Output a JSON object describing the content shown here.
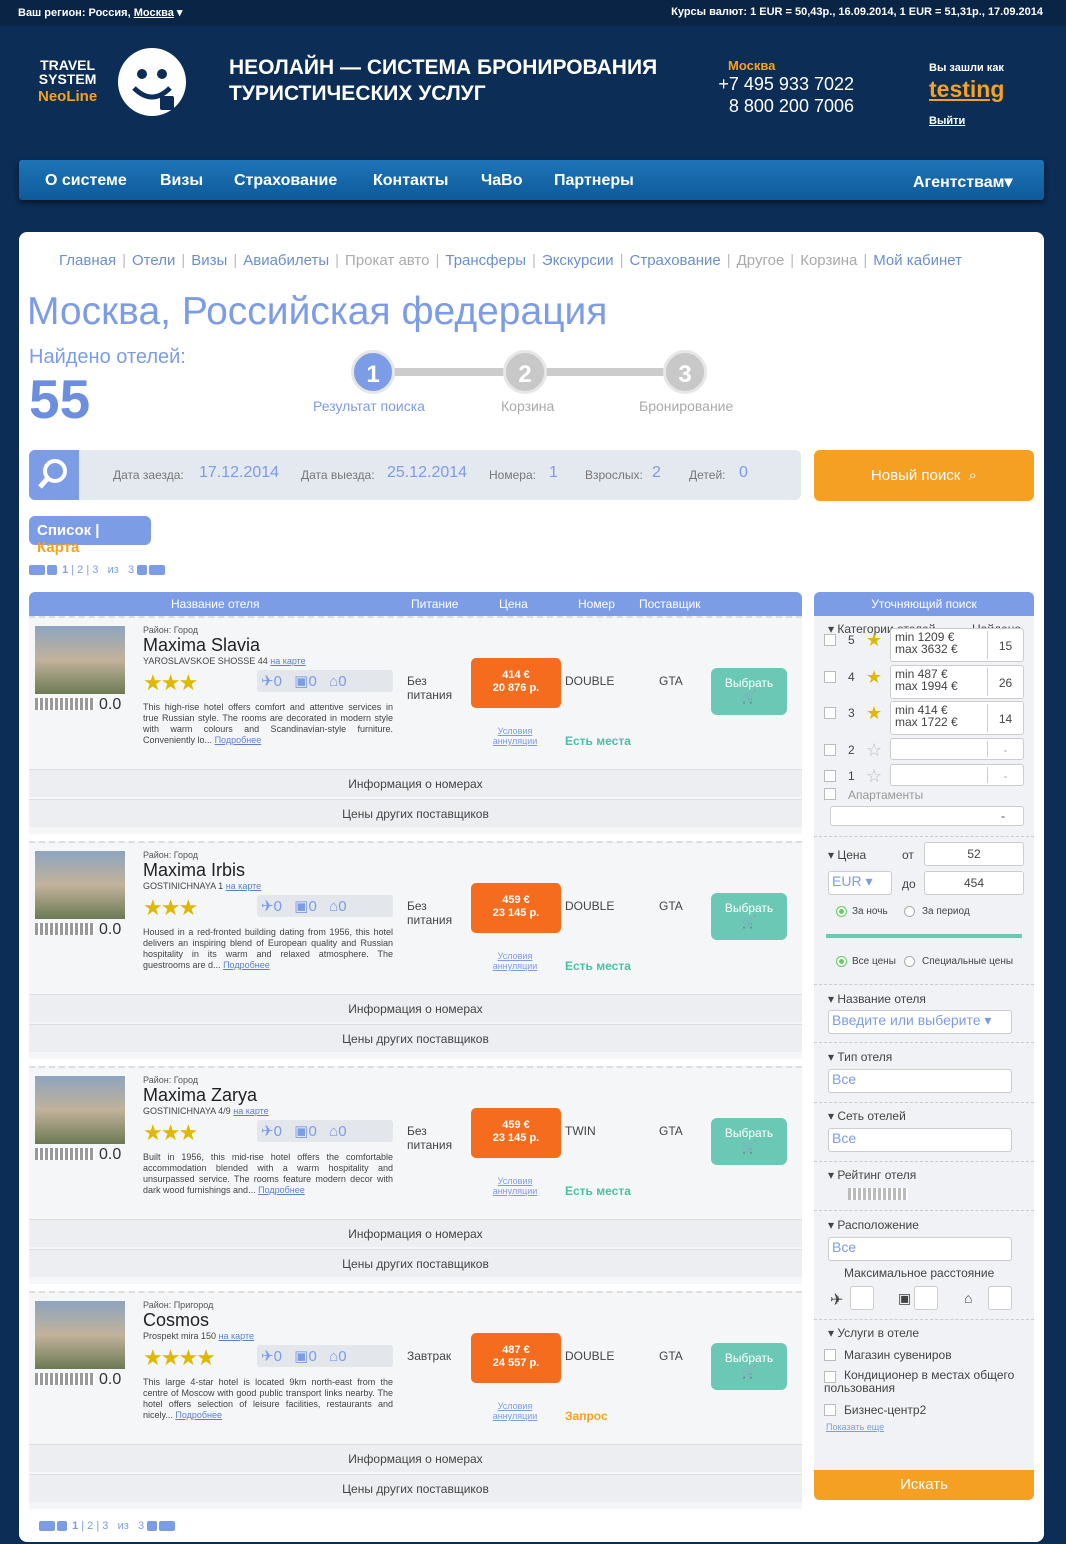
{
  "topbar": {
    "region_label": "Ваш регион: Россия,",
    "region_value": "Москва",
    "rates": "Курсы валют: 1 EUR = 50,43р., 16.09.2014, 1 EUR = 51,31р., 17.09.2014"
  },
  "brand": {
    "line1": "TRAVEL",
    "line2": "SYSTEM",
    "line3": "NeoLine",
    "headline1": "НЕОЛАЙН — СИСТЕМА БРОНИРОВАНИЯ",
    "headline2": "ТУРИСТИЧЕСКИХ УСЛУГ"
  },
  "contacts": {
    "city": "Москва",
    "phone1": "+7 495 933 7022",
    "phone2": "8 800 200 7006"
  },
  "user": {
    "label": "Вы зашли как",
    "name": "testing",
    "logout": "Выйти"
  },
  "nav": {
    "items": [
      "О системе",
      "Визы",
      "Страхование",
      "Контакты",
      "ЧаВо",
      "Партнеры"
    ],
    "agencies": "Агентствам"
  },
  "crumbs": [
    "Главная",
    "Отели",
    "Визы",
    "Авиабилеты",
    "Прокат авто",
    "Трансферы",
    "Экскурсии",
    "Страхование",
    "Другое",
    "Корзина",
    "Мой кабинет"
  ],
  "page": {
    "title": "Москва, Российская федерация",
    "found_label": "Найдено отелей:",
    "found_count": "55"
  },
  "steps": [
    {
      "n": "1",
      "label": "Результат поиска"
    },
    {
      "n": "2",
      "label": "Корзина"
    },
    {
      "n": "3",
      "label": "Бронирование"
    }
  ],
  "search": {
    "checkin_label": "Дата заезда:",
    "checkin": "17.12.2014",
    "checkout_label": "Дата выезда:",
    "checkout": "25.12.2014",
    "rooms_label": "Номера:",
    "rooms": "1",
    "adults_label": "Взрослых:",
    "adults": "2",
    "kids_label": "Детей:",
    "kids": "0",
    "new_search": "Новый поиск"
  },
  "view": {
    "list": "Список",
    "map": "Карта"
  },
  "pager": {
    "p1": "1",
    "p2": "2",
    "p3": "3",
    "of": "из",
    "total": "3"
  },
  "listhead": {
    "name": "Название отеля",
    "meal": "Питание",
    "price": "Цена",
    "room": "Номер",
    "provider": "Поставщик"
  },
  "hotels": [
    {
      "district": "Район: Город",
      "name": "Maxima Slavia",
      "addr": "YAROSLAVSKOE SHOSSE 44",
      "map": "на карте",
      "stars": "★★★",
      "d1": "0",
      "d2": "0",
      "d3": "0",
      "score": "0.0",
      "desc": "This high-rise hotel offers comfort and attentive services in true Russian style. The rooms are decorated in modern style with warm colours and Scandinavian-style furniture. Conveniently lo...",
      "more": "Подробнее",
      "meal": "Без питания",
      "eur": "414 €",
      "rub": "20 876 р.",
      "cancel": "Условия аннуляции",
      "room": "DOUBLE",
      "provider": "GTA",
      "avail": "Есть места",
      "choose": "Выбрать",
      "info": "Информация о номерах",
      "other": "Цены других поставщиков"
    },
    {
      "district": "Район: Город",
      "name": "Maxima Irbis",
      "addr": "GOSTINICHNAYA 1",
      "map": "на карте",
      "stars": "★★★",
      "d1": "0",
      "d2": "0",
      "d3": "0",
      "score": "0.0",
      "desc": "Housed in a red-fronted building dating from 1956, this hotel delivers an inspiring blend of European quality and Russian hospitality in its warm and relaxed atmosphere. The guestrooms are d...",
      "more": "Подробнее",
      "meal": "Без питания",
      "eur": "459 €",
      "rub": "23 145 р.",
      "cancel": "Условия аннуляции",
      "room": "DOUBLE",
      "provider": "GTA",
      "avail": "Есть места",
      "choose": "Выбрать",
      "info": "Информация о номерах",
      "other": "Цены других поставщиков"
    },
    {
      "district": "Район: Город",
      "name": "Maxima Zarya",
      "addr": "GOSTINICHNAYA 4/9",
      "map": "на карте",
      "stars": "★★★",
      "d1": "0",
      "d2": "0",
      "d3": "0",
      "score": "0.0",
      "desc": "Built in 1956, this mid-rise hotel offers the comfortable accommodation blended with a warm hospitality and unsurpassed service. The rooms feature modern decor with dark wood furnishings and...",
      "more": "Подробнее",
      "meal": "Без питания",
      "eur": "459 €",
      "rub": "23 145 р.",
      "cancel": "Условия аннуляции",
      "room": "TWIN",
      "provider": "GTA",
      "avail": "Есть места",
      "choose": "Выбрать",
      "info": "Информация о номерах",
      "other": "Цены других поставщиков"
    },
    {
      "district": "Район: Пригород",
      "name": "Cosmos",
      "addr": "Prospekt mira 150",
      "map": "на карте",
      "stars": "★★★★",
      "d1": "0",
      "d2": "0",
      "d3": "0",
      "score": "0.0",
      "desc": "This large 4-star hotel is located 9km north-east from the centre of Moscow with good public transport links nearby. The hotel offers selection of leisure facilities, restaurants and nicely...",
      "more": "Подробнее",
      "meal": "Завтрак",
      "eur": "487 €",
      "rub": "24 557 р.",
      "cancel": "Условия аннуляции",
      "room": "DOUBLE",
      "provider": "GTA",
      "avail": "Запрос",
      "choose": "Выбрать",
      "info": "Информация о номерах",
      "other": "Цены других поставщиков"
    }
  ],
  "filter": {
    "title": "Уточняющий поиск",
    "cat_label": "Категории отелей",
    "found_label": "Найдено",
    "cats": [
      {
        "n": "5",
        "min": "min 1209 €",
        "max": "max 3632 €",
        "cnt": "15"
      },
      {
        "n": "4",
        "min": "min 487 €",
        "max": "max 1994 €",
        "cnt": "26"
      },
      {
        "n": "3",
        "min": "min 414 €",
        "max": "max 1722 €",
        "cnt": "14"
      },
      {
        "n": "2",
        "min": "",
        "max": "",
        "cnt": "-"
      },
      {
        "n": "1",
        "min": "",
        "max": "",
        "cnt": "-"
      }
    ],
    "apartments": "Апартаменты",
    "apt_cnt": "-",
    "price_label": "Цена",
    "from": "от",
    "to": "до",
    "price_from": "52",
    "price_to": "454",
    "currency": "EUR",
    "per_night": "За ночь",
    "per_period": "За период",
    "all_prices": "Все цены",
    "special": "Специальные цены",
    "hotel_name_label": "Название отеля",
    "hotel_name_ph": "Введите или выберите",
    "type_label": "Тип отеля",
    "type_value": "Все",
    "chain_label": "Сеть отелей",
    "chain_value": "Все",
    "rating_label": "Рейтинг отеля",
    "location_label": "Расположение",
    "location_value": "Все",
    "max_dist": "Максимальное расстояние",
    "services_label": "Услуги в отеле",
    "s1": "Магазин сувениров",
    "s2": "Кондиционер в местах общего пользования",
    "s3": "Бизнес-центр2",
    "more": "Показать еще",
    "go": "Искать"
  }
}
